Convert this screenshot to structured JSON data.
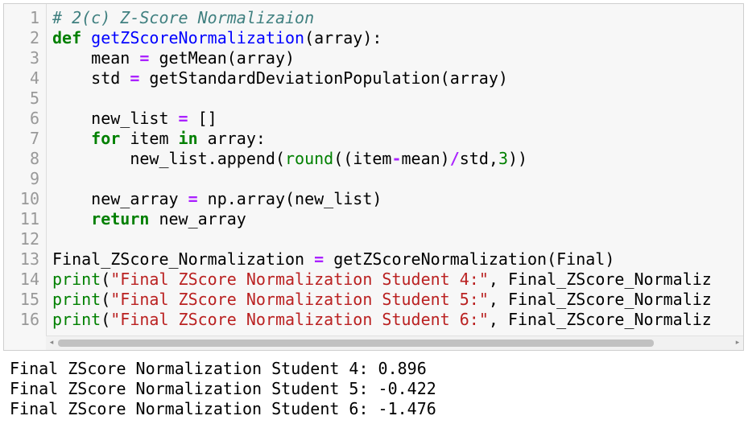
{
  "code_cell": {
    "lines": [
      {
        "n": "1"
      },
      {
        "n": "2"
      },
      {
        "n": "3"
      },
      {
        "n": "4"
      },
      {
        "n": "5"
      },
      {
        "n": "6"
      },
      {
        "n": "7"
      },
      {
        "n": "8"
      },
      {
        "n": "9"
      },
      {
        "n": "10"
      },
      {
        "n": "11"
      },
      {
        "n": "12"
      },
      {
        "n": "13"
      },
      {
        "n": "14"
      },
      {
        "n": "15"
      },
      {
        "n": "16"
      }
    ],
    "t": {
      "l1_comment": "# 2(c) Z-Score Normalizaion",
      "l2_def": "def",
      "l2_fn": "getZScoreNormalization",
      "l2_rest": "(array):",
      "l3_a": "    mean ",
      "l3_eq": "=",
      "l3_b": " getMean(array)",
      "l4_a": "    std ",
      "l4_eq": "=",
      "l4_b": " getStandardDeviationPopulation(array)",
      "l6_a": "    new_list ",
      "l6_eq": "=",
      "l6_b": " []",
      "l7_indent": "    ",
      "l7_for": "for",
      "l7_mid": " item ",
      "l7_in": "in",
      "l7_rest": " array:",
      "l8_a": "        new_list.append(",
      "l8_round": "round",
      "l8_b": "((item",
      "l8_minus": "-",
      "l8_c": "mean)",
      "l8_div": "/",
      "l8_d": "std,",
      "l8_num": "3",
      "l8_e": "))",
      "l10_a": "    new_array ",
      "l10_eq": "=",
      "l10_b": " np.array(new_list)",
      "l11_indent": "    ",
      "l11_return": "return",
      "l11_rest": " new_array",
      "l13_a": "Final_ZScore_Normalization ",
      "l13_eq": "=",
      "l13_b": " getZScoreNormalization(Final)",
      "l14_print": "print",
      "l14_p": "(",
      "l14_str": "\"Final ZScore Normalization Student 4:\"",
      "l14_rest": ", Final_ZScore_Normaliz",
      "l15_print": "print",
      "l15_p": "(",
      "l15_str": "\"Final ZScore Normalization Student 5:\"",
      "l15_rest": ", Final_ZScore_Normaliz",
      "l16_print": "print",
      "l16_p": "(",
      "l16_str": "\"Final ZScore Normalization Student 6:\"",
      "l16_rest": ", Final_ZScore_Normaliz"
    }
  },
  "scrollbar": {
    "left_arrow": "◂",
    "right_arrow": "▸"
  },
  "output": {
    "lines": [
      "Final ZScore Normalization Student 4: 0.896",
      "Final ZScore Normalization Student 5: -0.422",
      "Final ZScore Normalization Student 6: -1.476"
    ]
  }
}
